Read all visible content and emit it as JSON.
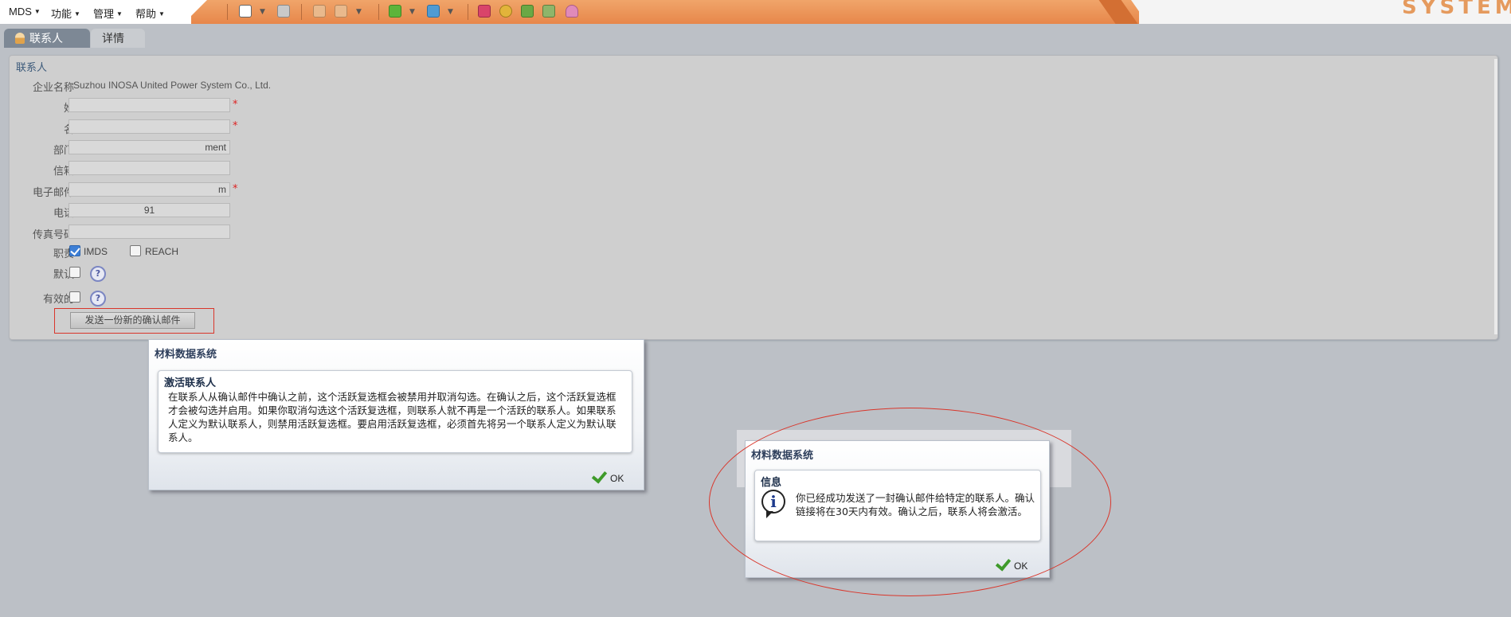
{
  "menu": {
    "items": [
      {
        "label": "MDS"
      },
      {
        "label": "功能"
      },
      {
        "label": "管理"
      },
      {
        "label": "帮助"
      }
    ]
  },
  "brand": {
    "text": "SYSTEM"
  },
  "toolbar": {
    "icons": [
      "new-document-icon",
      "save-icon",
      "copy-icon",
      "paste-icon",
      "import-icon",
      "export-icon",
      "settings-icon",
      "globe-icon",
      "sync-icon",
      "print-icon",
      "flask-icon"
    ]
  },
  "tabs": [
    {
      "label": "联系人"
    },
    {
      "label": "详情"
    }
  ],
  "form": {
    "section_title": "联系人",
    "company_label": "企业名称",
    "company_value": "Suzhou INOSA United Power System Co., Ltd.",
    "surname_label": "姓",
    "surname_value": "",
    "given_label": "名",
    "given_value": "",
    "dept_label": "部门",
    "dept_value": "ment",
    "mailbox_label": "信箱",
    "mailbox_value": "",
    "email_label": "电子邮件",
    "email_value": "m",
    "phone_label": "电话",
    "phone_value": "91",
    "fax_label": "传真号码",
    "fax_value": "",
    "duty_label": "职责",
    "duty_imds": "IMDS",
    "duty_reach": "REACH",
    "default_label": "默认",
    "active_label": "有效的",
    "required_mark": "*",
    "help_mark": "?",
    "send_button": "发送一份新的确认邮件"
  },
  "dialog1": {
    "title": "材料数据系统",
    "heading": "激活联系人",
    "body": "在联系人从确认邮件中确认之前，这个活跃复选框会被禁用并取消勾选。在确认之后，这个活跃复选框才会被勾选并启用。如果你取消勾选这个活跃复选框，则联系人就不再是一个活跃的联系人。如果联系人定义为默认联系人，则禁用活跃复选框。要启用活跃复选框，必须首先将另一个联系人定义为默认联系人。",
    "ok": "OK"
  },
  "dialog2": {
    "title": "材料数据系统",
    "heading": "信息",
    "body": "你已经成功发送了一封确认邮件给特定的联系人。确认链接将在30天内有效。确认之后，联系人将会激活。",
    "ok": "OK",
    "icon_glyph": "i"
  }
}
